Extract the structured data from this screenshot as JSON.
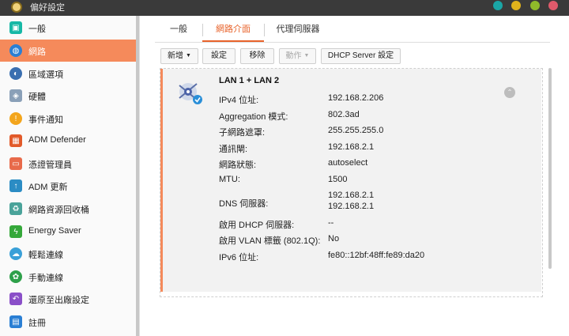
{
  "window": {
    "title": "偏好設定"
  },
  "sidebar": {
    "items": [
      {
        "label": "一般",
        "icon": "general-icon",
        "color": "#16b8a6",
        "active": false
      },
      {
        "label": "網路",
        "icon": "globe-icon",
        "color": "#2a7fd4",
        "active": true
      },
      {
        "label": "區域選項",
        "icon": "region-icon",
        "color": "#3a6fb0",
        "active": false
      },
      {
        "label": "硬體",
        "icon": "hardware-icon",
        "color": "#8aa0b8",
        "active": false
      },
      {
        "label": "事件通知",
        "icon": "alert-icon",
        "color": "#f3a51c",
        "active": false
      },
      {
        "label": "ADM Defender",
        "icon": "firewall-icon",
        "color": "#e25a2a",
        "active": false
      },
      {
        "label": "憑證管理員",
        "icon": "certificate-icon",
        "color": "#e86a4a",
        "active": false
      },
      {
        "label": "ADM 更新",
        "icon": "update-icon",
        "color": "#2b8cc4",
        "active": false
      },
      {
        "label": "網路資源回收桶",
        "icon": "recycle-icon",
        "color": "#4aa39a",
        "active": false
      },
      {
        "label": "Energy Saver",
        "icon": "energy-icon",
        "color": "#35a83a",
        "active": false
      },
      {
        "label": "輕鬆連線",
        "icon": "cloud-icon",
        "color": "#3aa0d8",
        "active": false
      },
      {
        "label": "手動連線",
        "icon": "manual-connect-icon",
        "color": "#2ea04a",
        "active": false
      },
      {
        "label": "還原至出廠設定",
        "icon": "restore-icon",
        "color": "#8a4fc8",
        "active": false
      },
      {
        "label": "註冊",
        "icon": "register-icon",
        "color": "#2a7fd4",
        "active": false
      }
    ]
  },
  "tabs": [
    {
      "label": "一般",
      "active": false
    },
    {
      "label": "網路介面",
      "active": true
    },
    {
      "label": "代理伺服器",
      "active": false
    }
  ],
  "toolbar": {
    "add_label": "新增",
    "settings_label": "設定",
    "remove_label": "移除",
    "action_label": "動作",
    "dhcp_label": "DHCP Server 設定"
  },
  "interface": {
    "title": "LAN 1 + LAN 2",
    "rows": [
      {
        "label": "IPv4 位址:",
        "value": "192.168.2.206"
      },
      {
        "label": "Aggregation 模式:",
        "value": "802.3ad"
      },
      {
        "label": "子網路遮罩:",
        "value": "255.255.255.0"
      },
      {
        "label": "通訊閘:",
        "value": "192.168.2.1"
      },
      {
        "label": "網路狀態:",
        "value": "autoselect"
      },
      {
        "label": "MTU:",
        "value": "1500"
      },
      {
        "label": "DNS 伺服器:",
        "value": "192.168.2.1",
        "value2": "192.168.2.1"
      },
      {
        "label": "啟用 DHCP 伺服器:",
        "value": "--"
      },
      {
        "label": "啟用 VLAN 標籤 (802.1Q):",
        "value": "No"
      },
      {
        "label": "IPv6 位址:",
        "value": "fe80::12bf:48ff:fe89:da20"
      }
    ]
  },
  "colors": {
    "accent": "#f58a5b",
    "tab_active": "#e8632b"
  }
}
